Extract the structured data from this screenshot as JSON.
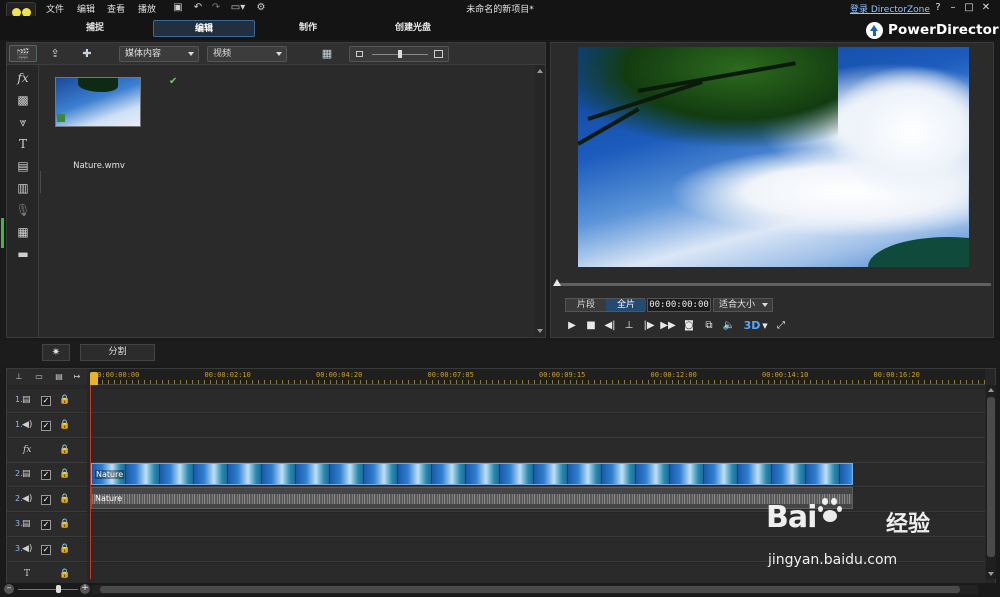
{
  "app": {
    "window_title": "未命名的新项目*",
    "brand_name": "PowerDirector",
    "login_link": "登录 DirectorZone"
  },
  "menu": [
    {
      "label": "文件"
    },
    {
      "label": "编辑"
    },
    {
      "label": "查看"
    },
    {
      "label": "播放"
    }
  ],
  "window_buttons": {
    "help": "?",
    "minimize": "–",
    "maximize": "□",
    "close": "✕"
  },
  "tabs": [
    {
      "label": "捕捉",
      "active": false
    },
    {
      "label": "编辑",
      "active": true
    },
    {
      "label": "制作",
      "active": false
    },
    {
      "label": "创建光盘",
      "active": false
    }
  ],
  "library": {
    "filter_dropdown": "媒体内容",
    "type_dropdown": "视频",
    "items": [
      {
        "label": "Nature.wmv",
        "checked": true
      }
    ]
  },
  "preview": {
    "mode_clip": "片段",
    "mode_movie": "全片",
    "timecode": "00:00:00:00",
    "fit_dropdown": "适合大小",
    "three_d_label": "3D"
  },
  "middle": {
    "split_button": "分割"
  },
  "timeline": {
    "ruler_labels": [
      "00:00:00:00",
      "00:00:02:10",
      "00:00:04:20",
      "00:00:07:05",
      "00:00:09:15",
      "00:00:12:00",
      "00:00:14:10",
      "00:00:16:20"
    ],
    "tracks": [
      {
        "id": "1.",
        "kind": "video",
        "checked": true
      },
      {
        "id": "1.",
        "kind": "audio",
        "checked": true
      },
      {
        "id": "",
        "kind": "fx",
        "checked": false
      },
      {
        "id": "2.",
        "kind": "video",
        "checked": true
      },
      {
        "id": "2.",
        "kind": "audio",
        "checked": true
      },
      {
        "id": "3.",
        "kind": "video",
        "checked": true
      },
      {
        "id": "3.",
        "kind": "audio",
        "checked": true
      },
      {
        "id": "",
        "kind": "title",
        "checked": false
      }
    ],
    "video_clip_label": "Nature",
    "audio_clip_label": "Nature"
  },
  "watermark": {
    "logo_text": "Bai",
    "logo_text_tail": "经验",
    "url": "jingyan.baidu.com"
  },
  "colors": {
    "accent_blue": "#3d6a94",
    "playhead": "#c43a22",
    "ruler_text": "#c9a227",
    "check_green": "#5fd35f"
  }
}
